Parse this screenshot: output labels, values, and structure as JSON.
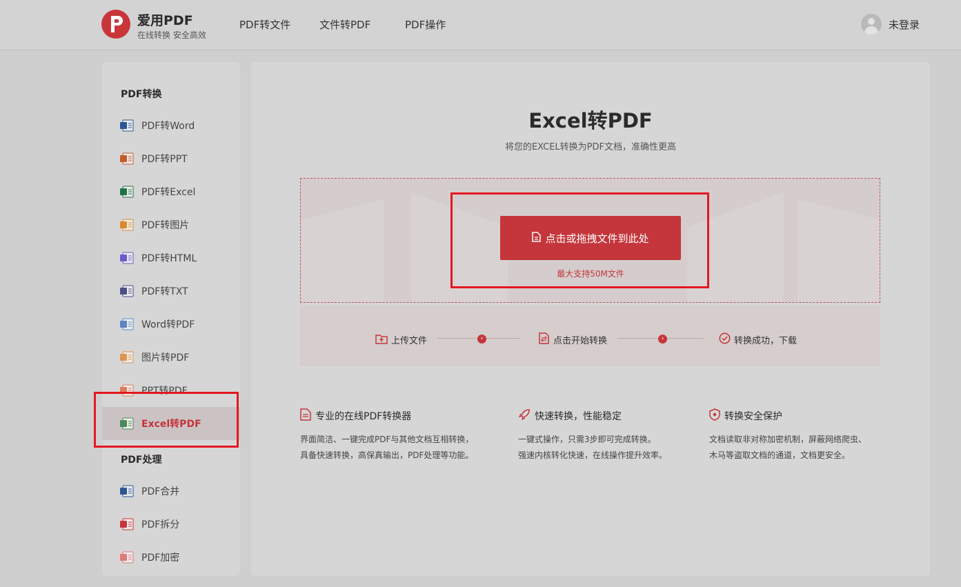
{
  "header": {
    "brand_name": "爱用PDF",
    "brand_slogan": "在线转换 安全高效",
    "nav": [
      "PDF转文件",
      "文件转PDF",
      "PDF操作"
    ],
    "user_label": "未登录"
  },
  "sidebar": {
    "section1_title": "PDF转换",
    "section2_title": "PDF处理",
    "items": [
      {
        "label": "PDF转Word",
        "icon": "word-file-icon",
        "color": "#2b5797"
      },
      {
        "label": "PDF转PPT",
        "icon": "ppt-file-icon",
        "color": "#c55a2a"
      },
      {
        "label": "PDF转Excel",
        "icon": "excel-file-icon",
        "color": "#217346"
      },
      {
        "label": "PDF转图片",
        "icon": "image-file-icon",
        "color": "#d98a2b"
      },
      {
        "label": "PDF转HTML",
        "icon": "html-file-icon",
        "color": "#6a5acd"
      },
      {
        "label": "PDF转TXT",
        "icon": "txt-file-icon",
        "color": "#4a4f8a"
      },
      {
        "label": "Word转PDF",
        "icon": "word-to-pdf-icon",
        "color": "#5b85c4"
      },
      {
        "label": "图片转PDF",
        "icon": "image-to-pdf-icon",
        "color": "#e0944d"
      },
      {
        "label": "PPT转PDF",
        "icon": "ppt-to-pdf-icon",
        "color": "#e07b5a"
      },
      {
        "label": "Excel转PDF",
        "icon": "excel-to-pdf-icon",
        "color": "#4a8a5a"
      }
    ],
    "items2": [
      {
        "label": "PDF合并",
        "icon": "pdf-merge-icon",
        "color": "#2b5797"
      },
      {
        "label": "PDF拆分",
        "icon": "pdf-split-icon",
        "color": "#c4363b"
      },
      {
        "label": "PDF加密",
        "icon": "pdf-encrypt-icon",
        "color": "#e07b7b"
      }
    ]
  },
  "main": {
    "title": "Excel转PDF",
    "subtitle": "将您的EXCEL转换为PDF文档，准确性更高",
    "upload_button": "点击或拖拽文件到此处",
    "upload_limit": "最大支持50M文件",
    "steps": [
      "上传文件",
      "点击开始转换",
      "转换成功，下载"
    ],
    "features": [
      {
        "title": "专业的在线PDF转换器",
        "desc": "界面简洁、一键完成PDF与其他文档互相转换，\n具备快速转换，高保真输出，PDF处理等功能。",
        "icon": "document-icon"
      },
      {
        "title": "快速转换，性能稳定",
        "desc": "一键式操作，只需3步即可完成转换。\n强速内核转化快速，在线操作提升效率。",
        "icon": "rocket-icon"
      },
      {
        "title": "转换安全保护",
        "desc": "文档读取非对称加密机制，屏蔽网络爬虫、\n木马等盗取文档的通道，文档更安全。",
        "icon": "shield-icon"
      }
    ]
  },
  "colors": {
    "accent": "#c4363b",
    "highlight": "#e3171f"
  }
}
